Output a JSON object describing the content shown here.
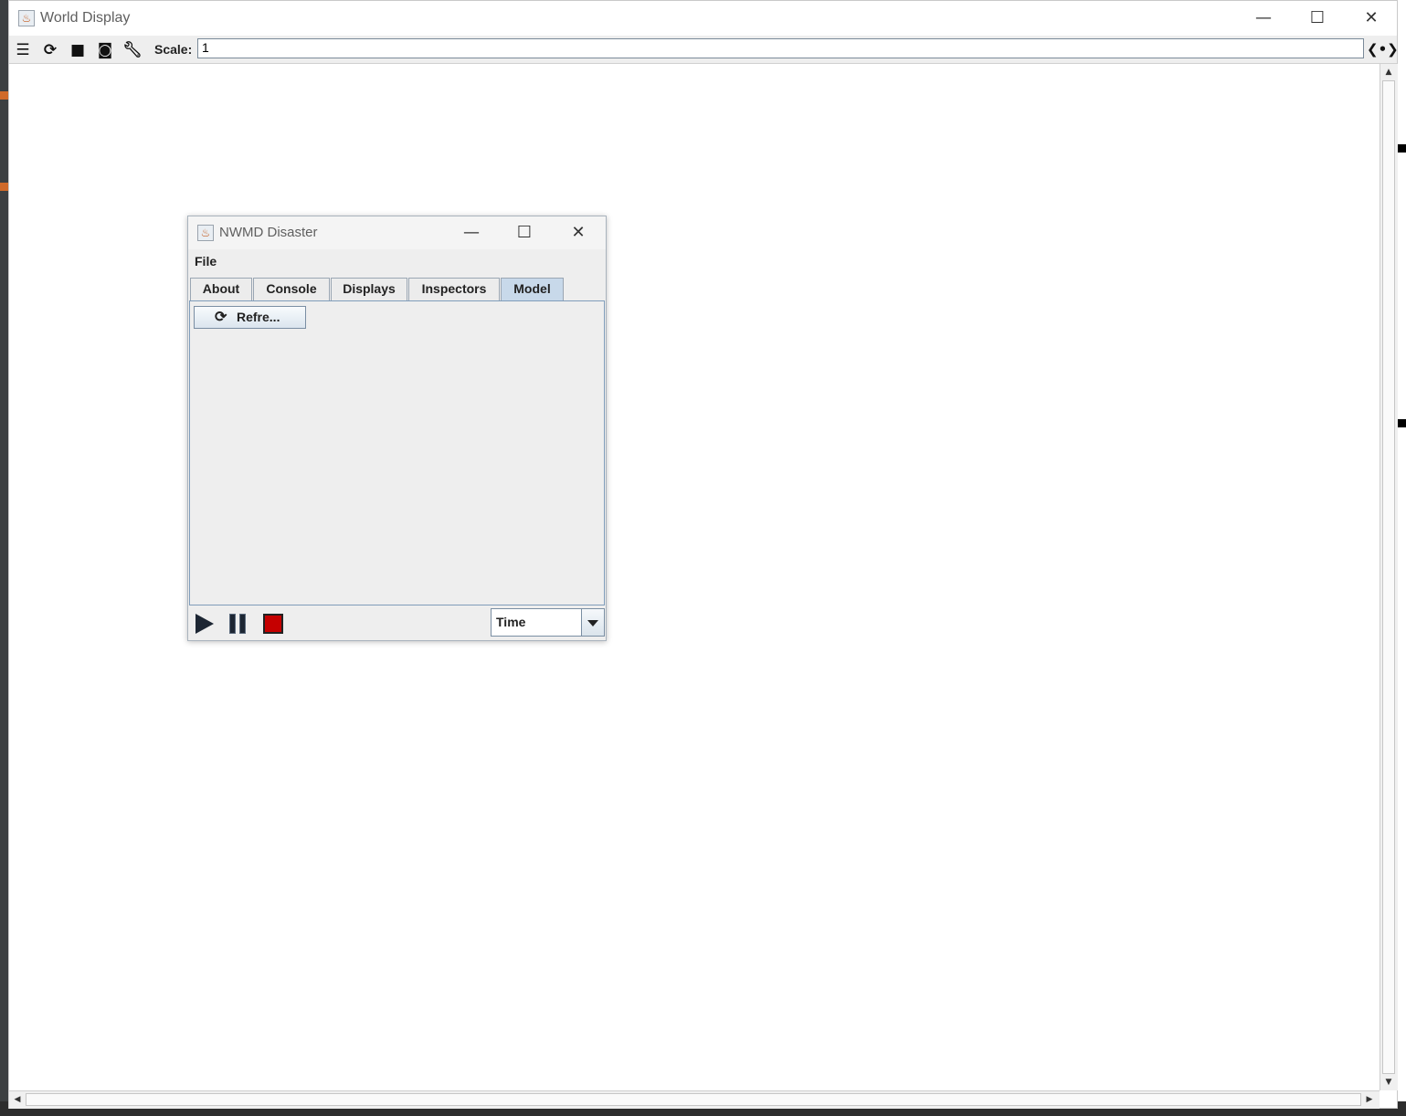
{
  "main_window": {
    "title": "World Display",
    "controls": {
      "minimize": "—",
      "maximize": "☐",
      "close": "✕"
    },
    "toolbar": {
      "icons": [
        "layers-icon",
        "refresh-icon",
        "movie-icon",
        "camera-icon",
        "wrench-icon"
      ],
      "scale_label": "Scale:",
      "scale_value": "1"
    }
  },
  "dialog": {
    "title": "NWMD Disaster",
    "controls": {
      "minimize": "—",
      "maximize": "☐",
      "close": "✕"
    },
    "menu": {
      "file": "File"
    },
    "tabs": [
      {
        "label": "About"
      },
      {
        "label": "Console"
      },
      {
        "label": "Displays"
      },
      {
        "label": "Inspectors"
      },
      {
        "label": "Model"
      }
    ],
    "active_tab": "Model",
    "refresh_button": "Refre...",
    "time_select": {
      "value": "Time"
    }
  }
}
